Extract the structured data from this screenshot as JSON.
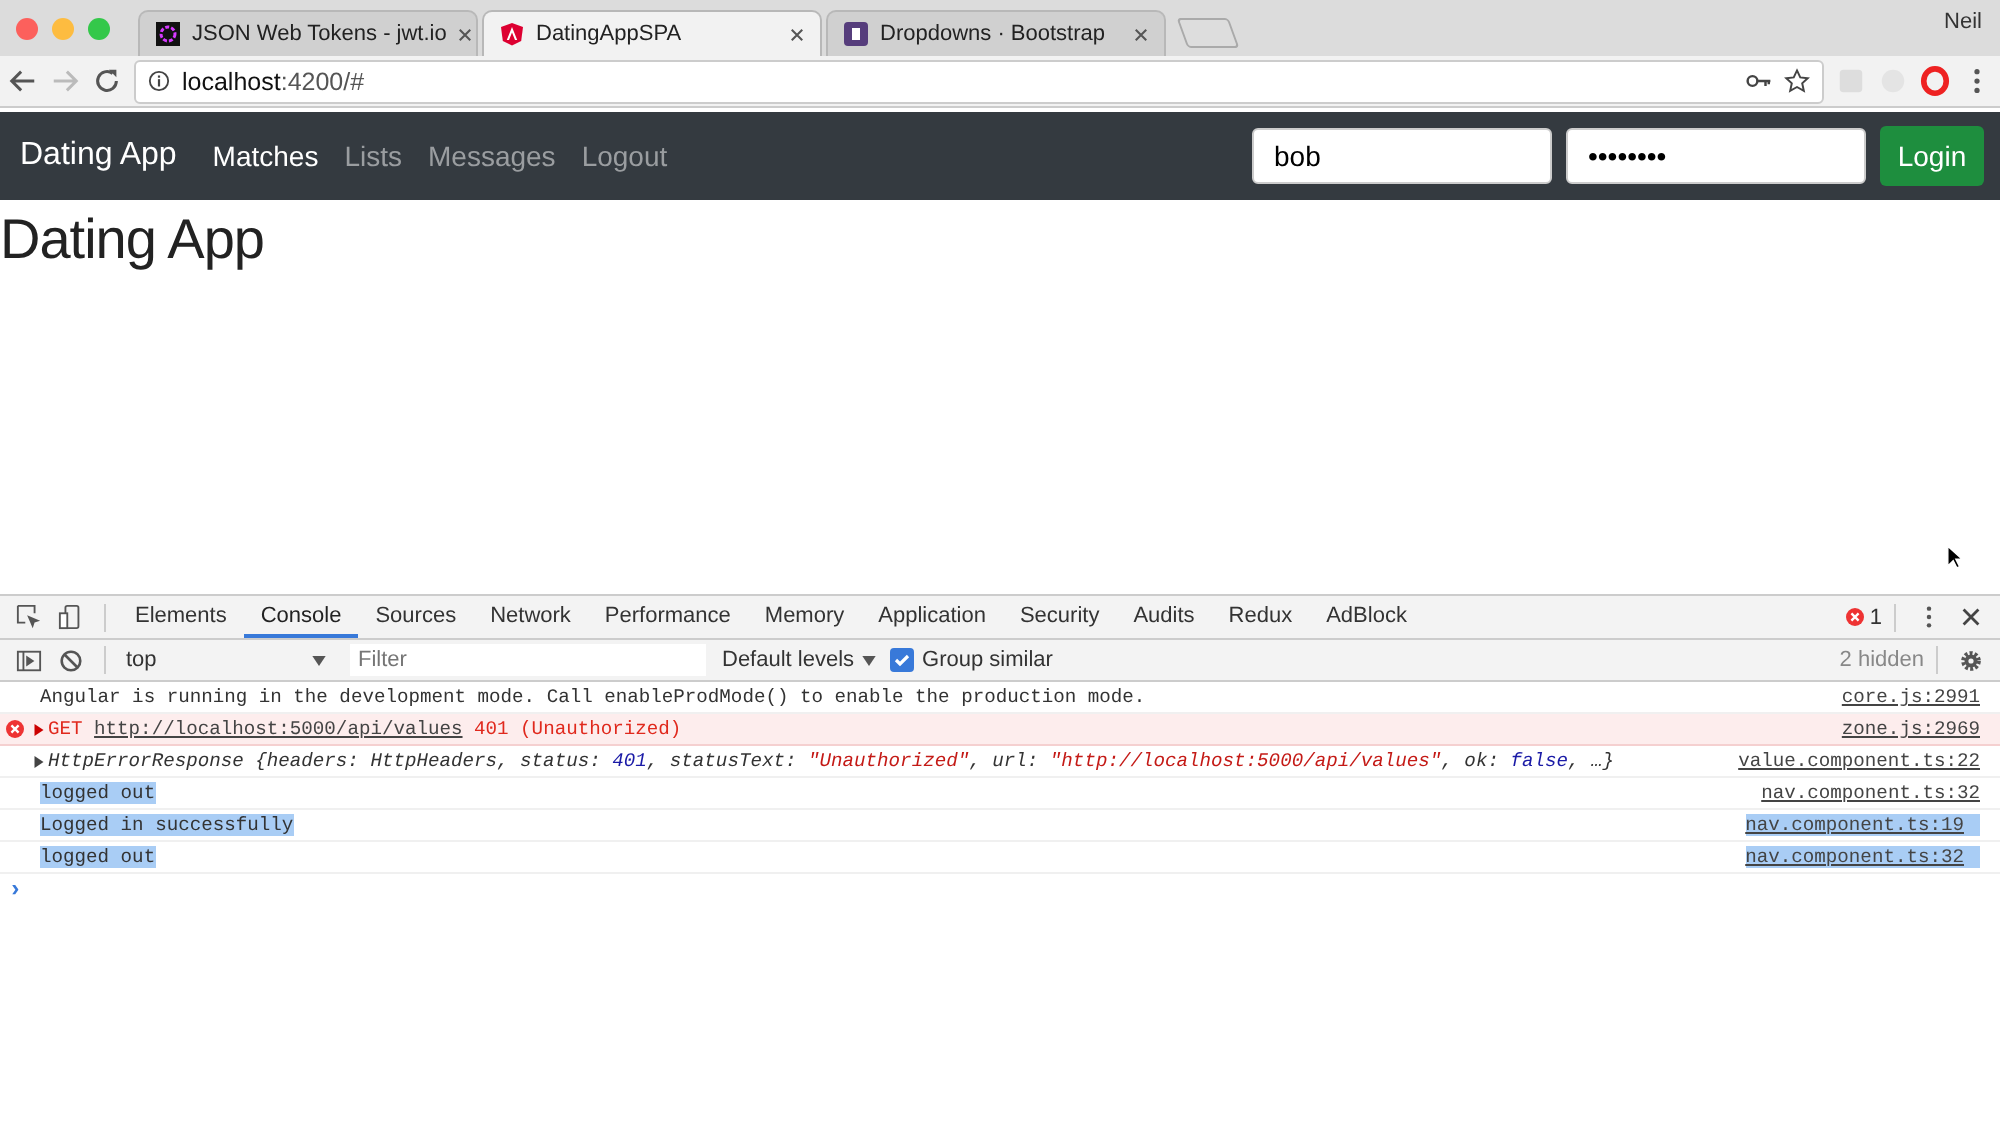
{
  "browser_tabs": [
    {
      "title": "JSON Web Tokens - jwt.io",
      "kind": "jwt",
      "selected": false
    },
    {
      "title": "DatingAppSPA",
      "kind": "angular",
      "selected": true
    },
    {
      "title": "Dropdowns · Bootstrap",
      "kind": "bootstrap",
      "selected": false
    }
  ],
  "profile": "Neil",
  "address": {
    "host": "localhost",
    "rest": ":4200/#"
  },
  "navbar": {
    "brand": "Dating App",
    "links": [
      {
        "label": "Matches",
        "selected": true
      },
      {
        "label": "Lists",
        "selected": false
      },
      {
        "label": "Messages",
        "selected": false
      },
      {
        "label": "Logout",
        "selected": false
      }
    ],
    "username": "bob",
    "password": "••••••••",
    "login": "Login"
  },
  "heading": "Dating App",
  "devtools": {
    "tabs": [
      {
        "label": "Elements",
        "selected": false
      },
      {
        "label": "Console",
        "selected": true
      },
      {
        "label": "Sources",
        "selected": false
      },
      {
        "label": "Network",
        "selected": false
      },
      {
        "label": "Performance",
        "selected": false
      },
      {
        "label": "Memory",
        "selected": false
      },
      {
        "label": "Application",
        "selected": false
      },
      {
        "label": "Security",
        "selected": false
      },
      {
        "label": "Audits",
        "selected": false
      },
      {
        "label": "Redux",
        "selected": false
      },
      {
        "label": "AdBlock",
        "selected": false
      }
    ],
    "error_count": "1",
    "context": "top",
    "filter_placeholder": "Filter",
    "levels": "Default levels",
    "group_similar": {
      "label": "Group similar",
      "checked": true
    },
    "hidden": "2 hidden",
    "lines": [
      {
        "kind": "info",
        "segments": [
          {
            "kind": "plain",
            "text": "Angular is running in the development mode. Call enableProdMode() to enable the production mode."
          }
        ],
        "source": "core.js:2991",
        "text_selected": false,
        "source_selected": false
      },
      {
        "kind": "error",
        "segments": [
          {
            "kind": "plain",
            "text": "GET "
          },
          {
            "kind": "link",
            "text": "http://localhost:5000/api/values"
          },
          {
            "kind": "plain",
            "text": " 401 (Unauthorized)"
          }
        ],
        "source": "zone.js:2969",
        "text_selected": false,
        "source_selected": false
      },
      {
        "kind": "object",
        "segments": [
          {
            "kind": "plain",
            "text": "HttpErrorResponse {headers: HttpHeaders, status: "
          },
          {
            "kind": "num",
            "text": "401"
          },
          {
            "kind": "plain",
            "text": ", statusText: "
          },
          {
            "kind": "str",
            "text": "\"Unauthorized\""
          },
          {
            "kind": "plain",
            "text": ", url: "
          },
          {
            "kind": "str",
            "text": "\"http://localhost:5000/api/values\""
          },
          {
            "kind": "plain",
            "text": ", ok: "
          },
          {
            "kind": "num",
            "text": "false"
          },
          {
            "kind": "plain",
            "text": ", …}"
          }
        ],
        "source": "value.component.ts:22",
        "text_selected": false,
        "source_selected": false
      },
      {
        "kind": "log",
        "segments": [
          {
            "kind": "plain",
            "text": "logged out"
          }
        ],
        "source": "nav.component.ts:32",
        "text_selected": true,
        "source_selected": false
      },
      {
        "kind": "log",
        "segments": [
          {
            "kind": "plain",
            "text": "Logged in successfully"
          }
        ],
        "source": "nav.component.ts:19",
        "text_selected": true,
        "source_selected": true
      },
      {
        "kind": "log",
        "segments": [
          {
            "kind": "plain",
            "text": "logged out"
          }
        ],
        "source": "nav.component.ts:32",
        "text_selected": true,
        "source_selected": true
      }
    ],
    "prompt": "›"
  }
}
